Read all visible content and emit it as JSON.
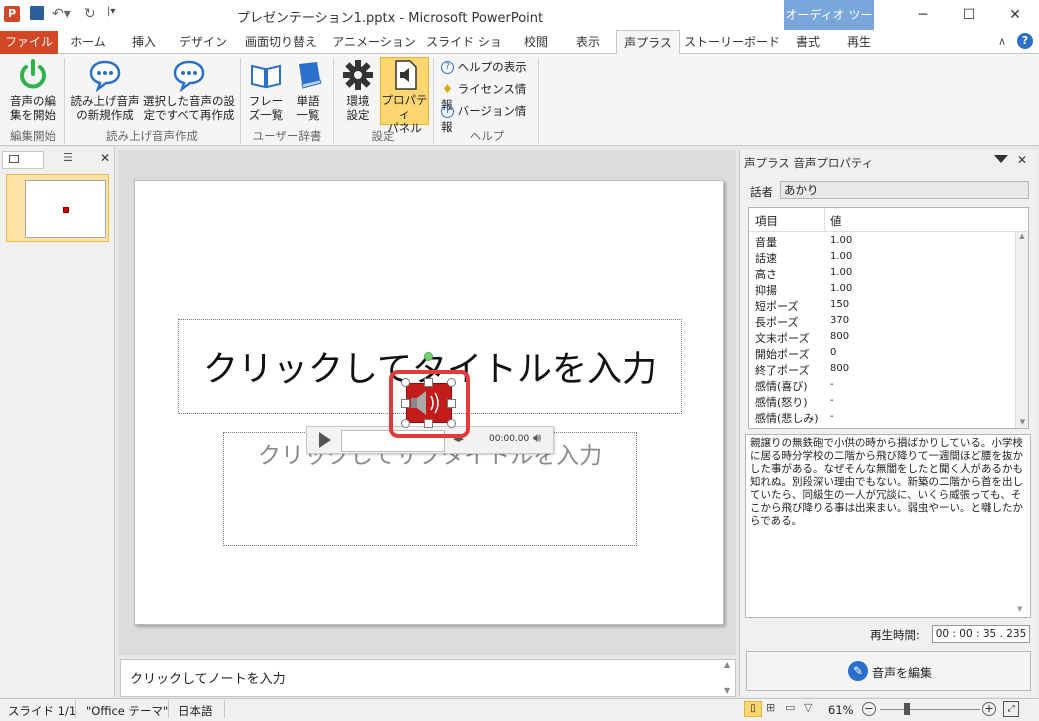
{
  "window": {
    "title": "プレゼンテーション1.pptx - Microsoft PowerPoint",
    "context_tab_group": "オーディオ ツール",
    "app_icon_letter": "P"
  },
  "tabs": {
    "file": "ファイル",
    "home": "ホーム",
    "insert": "挿入",
    "design": "デザイン",
    "transitions": "画面切り替え",
    "animations": "アニメーション",
    "slideshow": "スライド ショー",
    "review": "校閲",
    "view": "表示",
    "koeplus": "声プラス",
    "storyboard": "ストーリーボード",
    "format": "書式",
    "playback": "再生"
  },
  "ribbon": {
    "start_edit": [
      "音声の編",
      "集を開始"
    ],
    "group_edit": "編集開始",
    "new_voice": [
      "読み上げ音声",
      "の新規作成"
    ],
    "regen_selected": [
      "選択した音声の設",
      "定ですべて再作成"
    ],
    "group_voice": "読み上げ音声作成",
    "phrase_list": [
      "フレー",
      "ズ一覧"
    ],
    "word_list": [
      "単語",
      "一覧"
    ],
    "group_dict": "ユーザー辞書",
    "env_settings": [
      "環境",
      "設定"
    ],
    "property_panel": [
      "プロパティ",
      "パネル"
    ],
    "group_settings": "設定",
    "help_show": "ヘルプの表示",
    "license_info": "ライセンス情報",
    "version_info": "バージョン情報",
    "group_help": "ヘルプ"
  },
  "thumbs": {
    "slide_number": "1"
  },
  "slide": {
    "title_placeholder": "クリックしてタイトルを入力",
    "subtitle_placeholder": "クリックしてサブタイトルを入力",
    "audio_time": "00:00.00"
  },
  "notes": {
    "placeholder": "クリックしてノートを入力"
  },
  "panel": {
    "title": "声プラス 音声プロパティ",
    "speaker_label": "話者",
    "speaker_value": "あかり",
    "col_item": "項目",
    "col_value": "値",
    "rows": [
      {
        "k": "音量",
        "v": "1.00"
      },
      {
        "k": "話速",
        "v": "1.00"
      },
      {
        "k": "高さ",
        "v": "1.00"
      },
      {
        "k": "抑揚",
        "v": "1.00"
      },
      {
        "k": "短ポーズ",
        "v": "150"
      },
      {
        "k": "長ポーズ",
        "v": "370"
      },
      {
        "k": "文末ポーズ",
        "v": "800"
      },
      {
        "k": "開始ポーズ",
        "v": "0"
      },
      {
        "k": "終了ポーズ",
        "v": "800"
      },
      {
        "k": "感情(喜び)",
        "v": "-"
      },
      {
        "k": "感情(怒り)",
        "v": "-"
      },
      {
        "k": "感情(悲しみ)",
        "v": "-"
      }
    ],
    "text": "親譲りの無鉄砲で小供の時から損ばかりしている。小学校に居る時分学校の二階から飛び降りて一週間ほど腰を抜かした事がある。なぜそんな無闇をしたと聞く人があるかも知れぬ。別段深い理由でもない。新築の二階から首を出していたら、同級生の一人が冗談に、いくら威張っても、そこから飛び降りる事は出来まい。弱虫やーい。と囃したからである。",
    "playtime_label": "再生時間:",
    "playtime_value": "00 : 00 : 35 . 235",
    "edit_button": "音声を編集"
  },
  "status": {
    "slide": "スライド 1/1",
    "theme": "\"Office テーマ\"",
    "language": "日本語",
    "zoom": "61%"
  }
}
